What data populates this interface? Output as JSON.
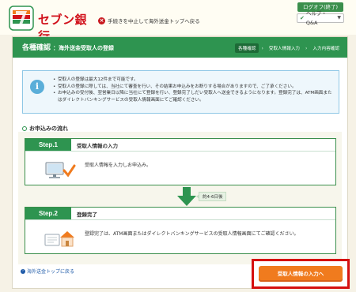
{
  "brand": {
    "name": "セブン銀行"
  },
  "header": {
    "interrupt_link": "手続きを中止して海外送金トップへ戻る",
    "logout_label": "ログオフ(終了)",
    "help_label": "ヘルプ・Q&A"
  },
  "page": {
    "title": "各種確認",
    "subtitle": "：海外送金受取人の登録",
    "steps": [
      "各種確認",
      "受取人情報入力",
      "入力内容確認"
    ]
  },
  "info": {
    "items": [
      "受取人の登録は最大12件まで可能です。",
      "受取人の登録に際しては、当社にて審査を行い、その結果お申込みをお断りする場合がありますので、ご了承ください。",
      "お申込みの受付後、翌営業日以降に当社にて登録を行い、登録完了しだい受取人へ送金できるようになります。登録完了は、ATM画面またはダイレクトバンキングサービスの受取人情報画面にてご確認ください。"
    ]
  },
  "flow": {
    "title": "お申込みの流れ",
    "step1": {
      "label": "Step.1",
      "heading": "受取人情報の入力",
      "desc": "受取人情報を入力しお申込み。"
    },
    "duration": "約4-6日後",
    "step2": {
      "label": "Step.2",
      "heading": "登録完了",
      "desc": "登録完了は、ATM画面またはダイレクトバンキングサービスの受取人情報画面にてご確認ください。"
    }
  },
  "footer": {
    "back_link": "海外送金トップに戻る",
    "cta_label": "受取人情報の入力へ"
  },
  "colors": {
    "brand_green": "#2e9450",
    "accent_orange": "#f07b1e",
    "highlight_red": "#d51010",
    "brand_red": "#d1111b"
  }
}
